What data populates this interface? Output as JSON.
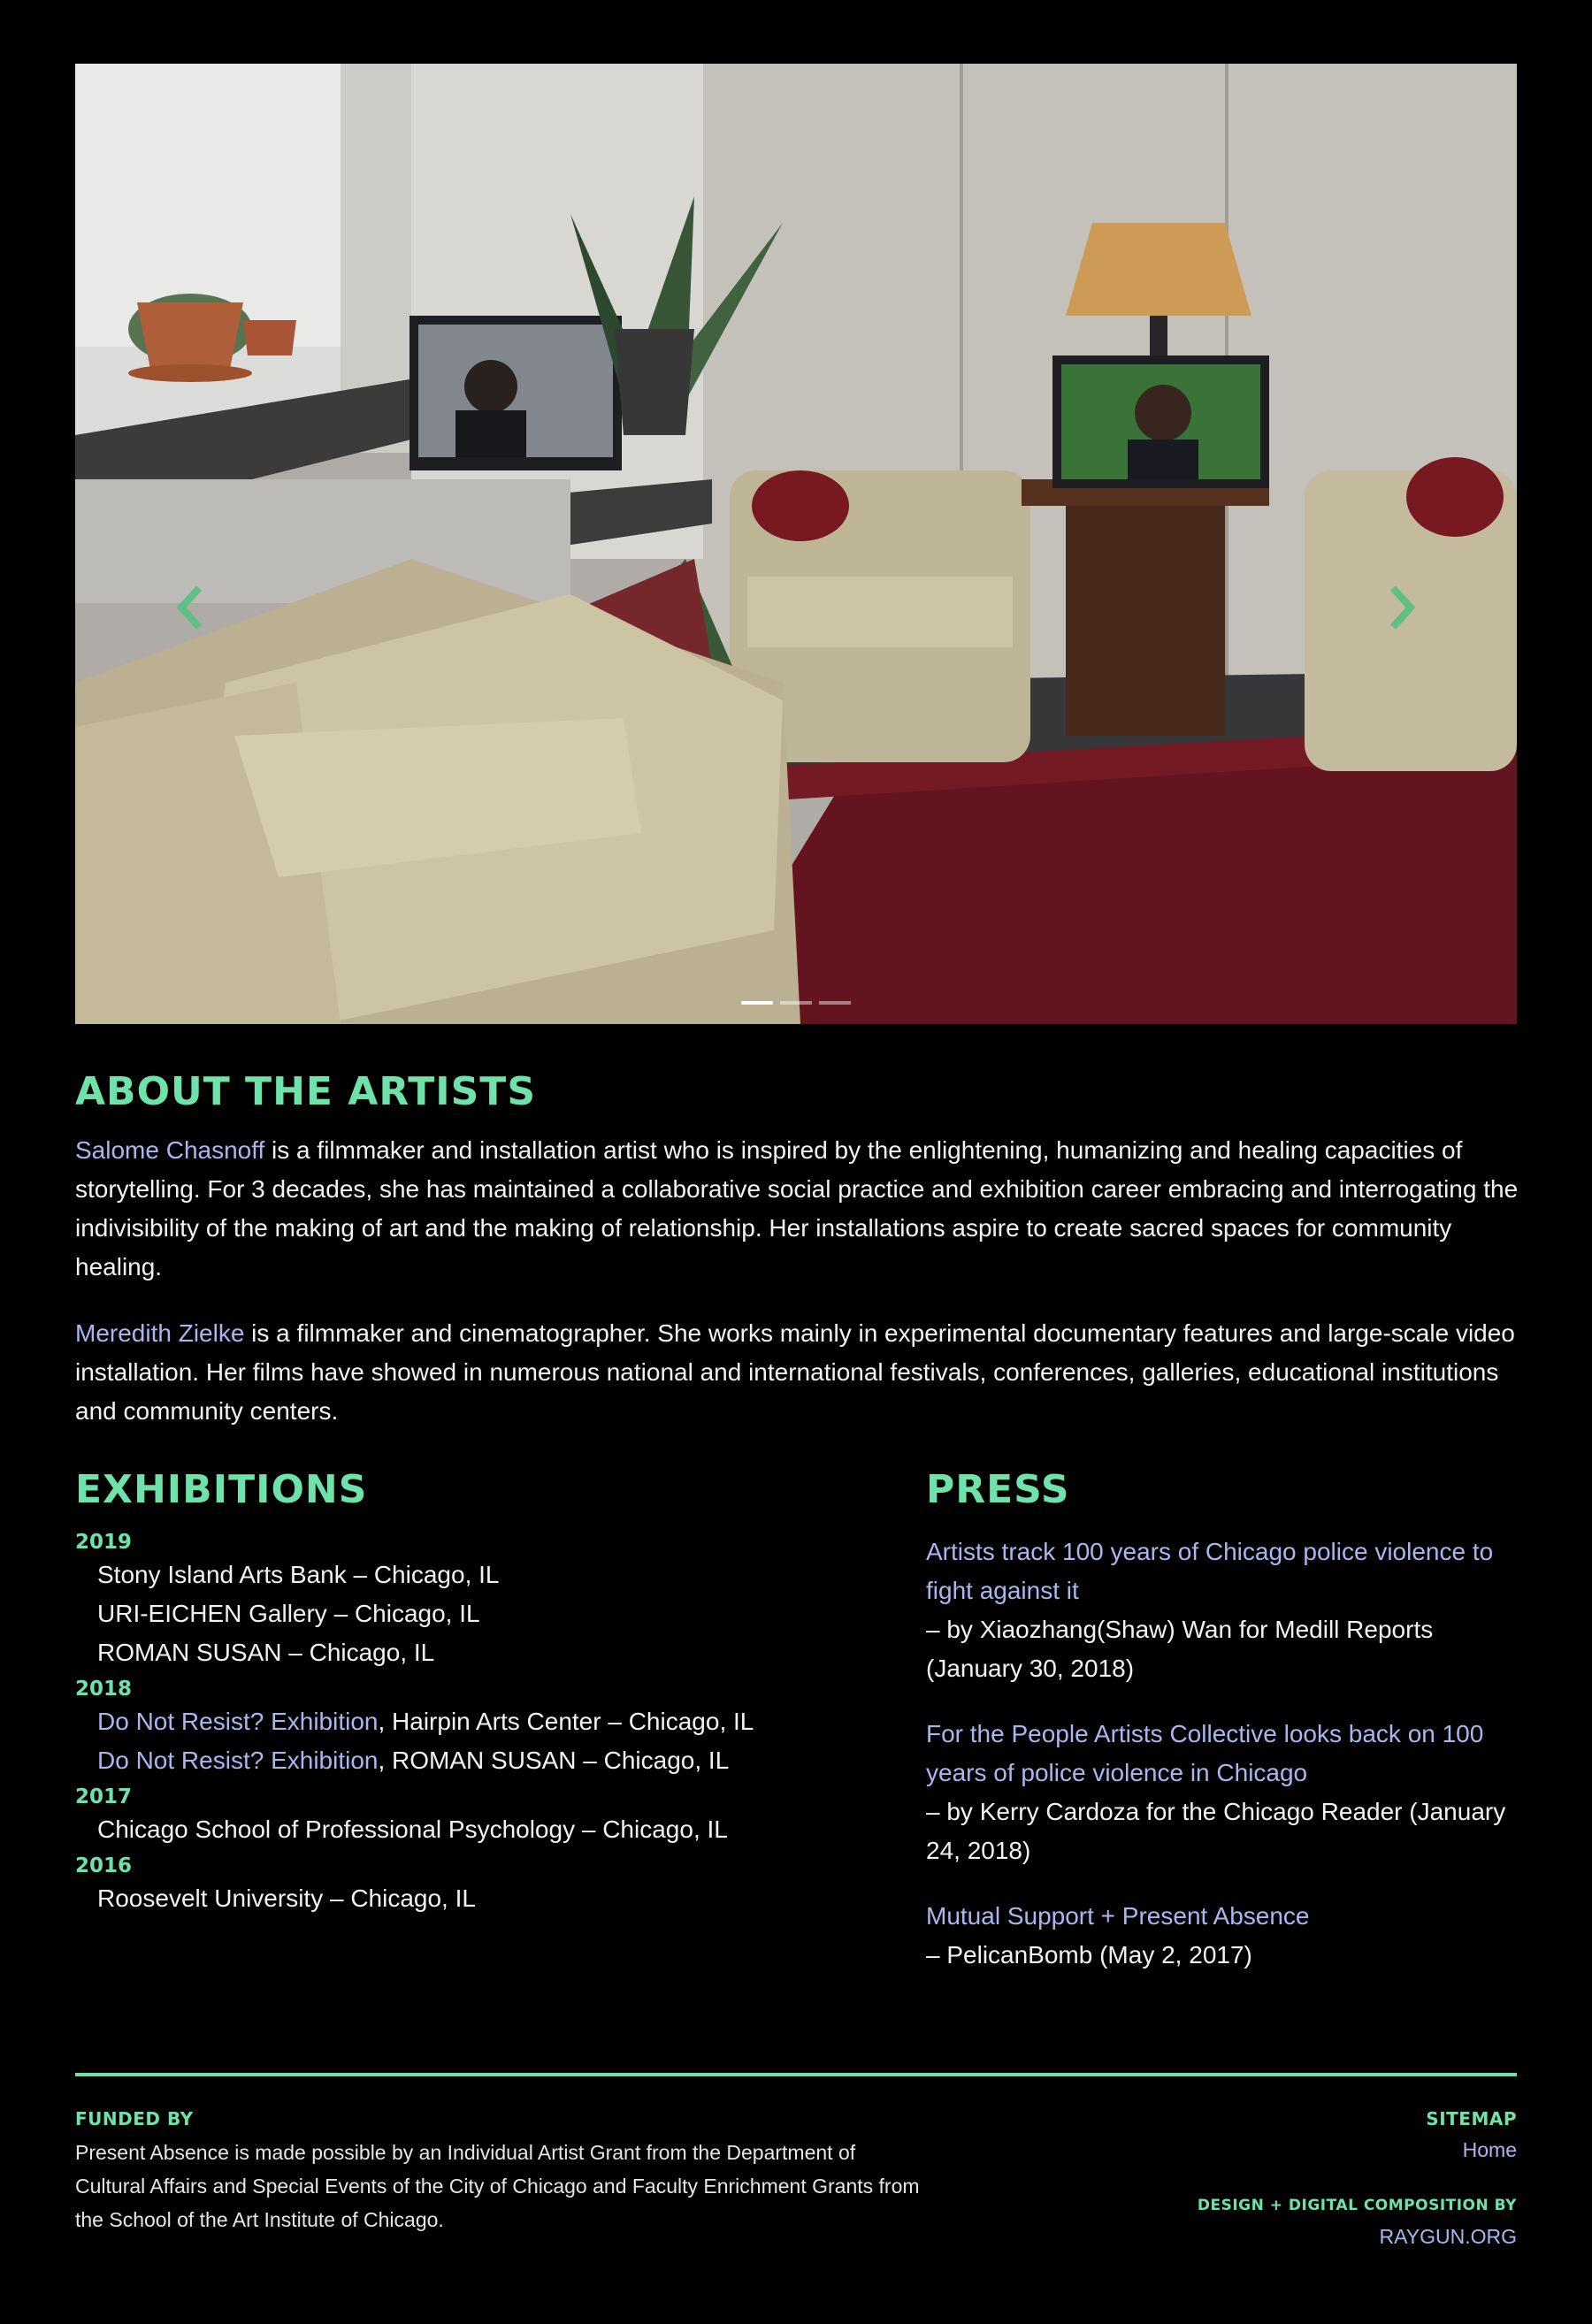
{
  "hero": {
    "prev_label": "‹",
    "next_label": "›",
    "prev_icon": "chevron-left-icon",
    "next_icon": "chevron-right-icon",
    "slide_count": 3,
    "active_slide": 1,
    "image_alt": "Installation view: living room with sofas, armchairs, lamp and two video monitors showing portraits"
  },
  "about": {
    "title": "ABOUT THE ARTISTS",
    "artist1": {
      "name": "Salome Chasnoff",
      "bio": " is a filmmaker and installation artist who is inspired by the enlightening, humanizing and healing capacities of storytelling. For 3 decades, she has maintained a collaborative social practice and exhibition career embracing and interrogating the indivisibility of the making of art and the making of relationship. Her installations aspire to create sacred spaces for community healing."
    },
    "artist2": {
      "name": "Meredith Zielke",
      "bio": " is a filmmaker and cinematographer. She works mainly in experimental documentary features and large-scale video installation. Her films have showed in numerous national and international festivals, conferences, galleries, educational institutions and community centers."
    }
  },
  "exhibitions": {
    "title": "EXHIBITIONS",
    "years": [
      {
        "year": "2019",
        "items": [
          {
            "link": "",
            "text": "Stony Island Arts Bank – Chicago, IL"
          },
          {
            "link": "",
            "text": "URI-EICHEN Gallery – Chicago, IL"
          },
          {
            "link": "",
            "text": "ROMAN SUSAN – Chicago, IL"
          }
        ]
      },
      {
        "year": "2018",
        "items": [
          {
            "link": "Do Not Resist? Exhibition",
            "text": ", Hairpin Arts Center – Chicago, IL"
          },
          {
            "link": "Do Not Resist? Exhibition",
            "text": ", ROMAN SUSAN – Chicago, IL"
          }
        ]
      },
      {
        "year": "2017",
        "items": [
          {
            "link": "",
            "text": "Chicago School of Professional Psychology – Chicago, IL"
          }
        ]
      },
      {
        "year": "2016",
        "items": [
          {
            "link": "",
            "text": "Roosevelt University – Chicago, IL"
          }
        ]
      }
    ]
  },
  "press": {
    "title": "PRESS",
    "items": [
      {
        "title": "Artists track 100 years of Chicago police violence to fight against it",
        "meta": "– by Xiaozhang(Shaw) Wan for Medill Reports (January 30, 2018)"
      },
      {
        "title": "For the People Artists Collective looks back on 100 years of police violence in Chicago",
        "meta": "– by Kerry Cardoza for the Chicago Reader (January 24, 2018)"
      },
      {
        "title": "Mutual Support + Present Absence",
        "meta": "– PelicanBomb (May 2, 2017)"
      }
    ]
  },
  "footer": {
    "funded_label": "FUNDED BY",
    "funded_text": "Present Absence is made possible by an Individual Artist Grant from the Department of Cultural Affairs and Special Events of the City of Chicago and Faculty Enrichment Grants from the School of the Art Institute of Chicago.",
    "sitemap_label": "SITEMAP",
    "home_link": "Home",
    "design_label": "DESIGN + DIGITAL COMPOSITION BY",
    "design_link": "RAYGUN.ORG"
  },
  "colors": {
    "background": "#000000",
    "accent_green": "#6ee3a9",
    "link_lavender": "#a9b7f0",
    "body_text": "#f2f2f2"
  }
}
